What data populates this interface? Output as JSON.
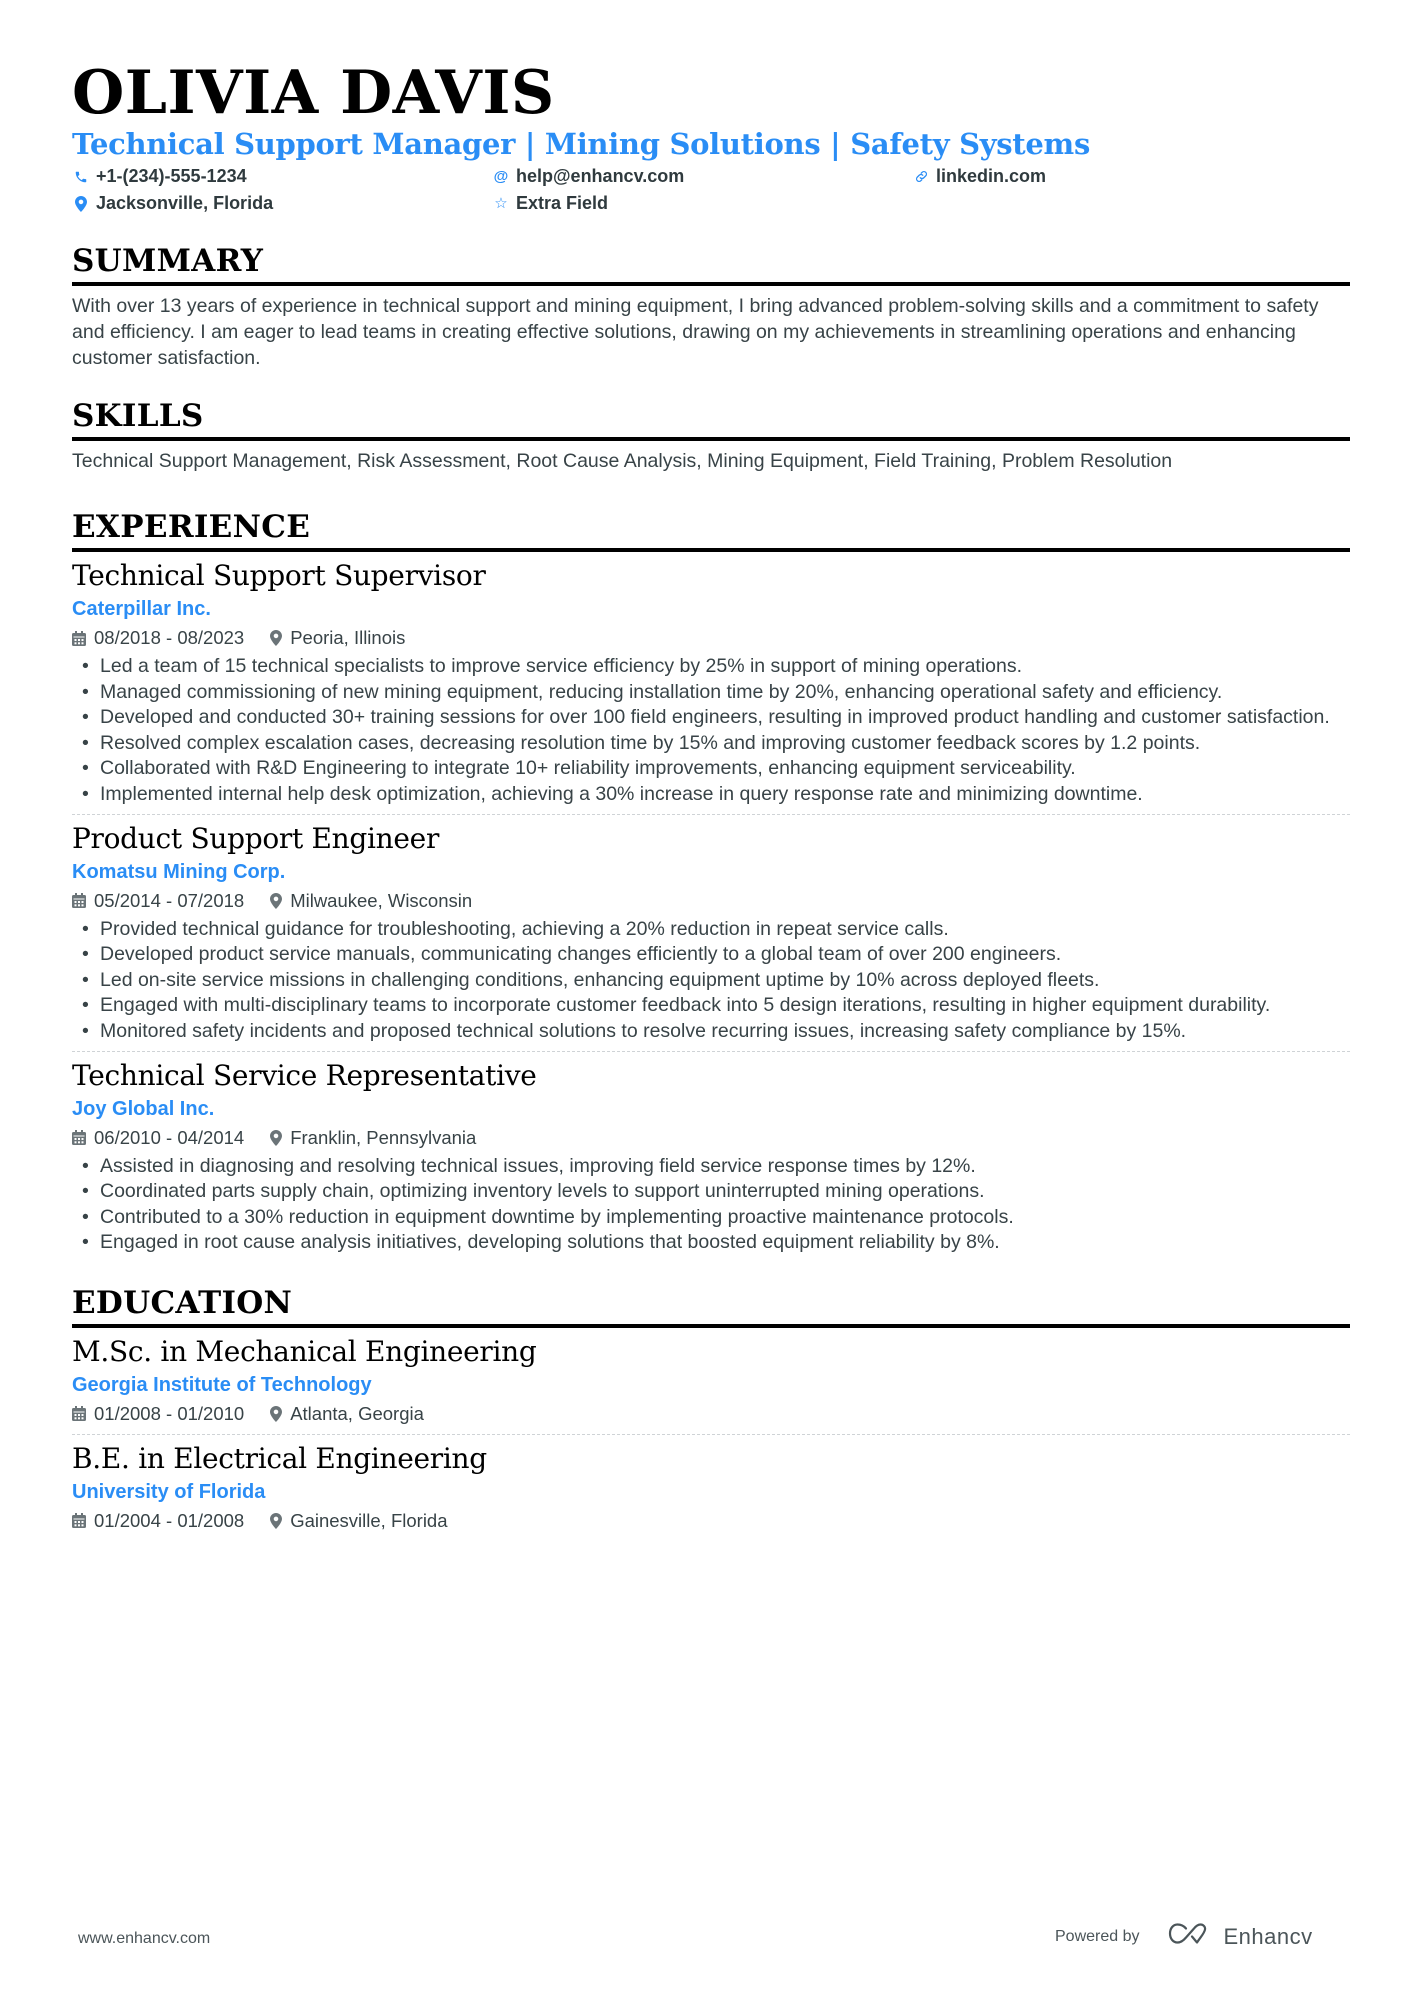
{
  "header": {
    "name": "OLIVIA DAVIS",
    "headline": "Technical Support Manager | Mining Solutions | Safety Systems",
    "contacts": [
      {
        "icon": "phone-icon",
        "value": "+1-(234)-555-1234"
      },
      {
        "icon": "at-icon",
        "value": "help@enhancv.com"
      },
      {
        "icon": "link-icon",
        "value": "linkedin.com"
      },
      {
        "icon": "location-icon",
        "value": "Jacksonville, Florida"
      },
      {
        "icon": "star-icon",
        "value": "Extra Field"
      }
    ]
  },
  "summary": {
    "title": "SUMMARY",
    "text": "With over 13 years of experience in technical support and mining equipment, I bring advanced problem-solving skills and a commitment to safety and efficiency. I am eager to lead teams in creating effective solutions, drawing on my achievements in streamlining operations and enhancing customer satisfaction."
  },
  "skills": {
    "title": "SKILLS",
    "text": "Technical Support Management, Risk Assessment, Root Cause Analysis, Mining Equipment, Field Training, Problem Resolution"
  },
  "experience": {
    "title": "EXPERIENCE",
    "items": [
      {
        "role": "Technical Support Supervisor",
        "company": "Caterpillar Inc.",
        "dates": "08/2018 - 08/2023",
        "location": "Peoria, Illinois",
        "bullets": [
          "Led a team of 15 technical specialists to improve service efficiency by 25% in support of mining operations.",
          "Managed commissioning of new mining equipment, reducing installation time by 20%, enhancing operational safety and efficiency.",
          "Developed and conducted 30+ training sessions for over 100 field engineers, resulting in improved product handling and customer satisfaction.",
          "Resolved complex escalation cases, decreasing resolution time by 15% and improving customer feedback scores by 1.2 points.",
          "Collaborated with R&D Engineering to integrate 10+ reliability improvements, enhancing equipment serviceability.",
          "Implemented internal help desk optimization, achieving a 30% increase in query response rate and minimizing downtime."
        ]
      },
      {
        "role": "Product Support Engineer",
        "company": "Komatsu Mining Corp.",
        "dates": "05/2014 - 07/2018",
        "location": "Milwaukee, Wisconsin",
        "bullets": [
          "Provided technical guidance for troubleshooting, achieving a 20% reduction in repeat service calls.",
          "Developed product service manuals, communicating changes efficiently to a global team of over 200 engineers.",
          "Led on-site service missions in challenging conditions, enhancing equipment uptime by 10% across deployed fleets.",
          "Engaged with multi-disciplinary teams to incorporate customer feedback into 5 design iterations, resulting in higher equipment durability.",
          "Monitored safety incidents and proposed technical solutions to resolve recurring issues, increasing safety compliance by 15%."
        ]
      },
      {
        "role": "Technical Service Representative",
        "company": "Joy Global Inc.",
        "dates": "06/2010 - 04/2014",
        "location": "Franklin, Pennsylvania",
        "bullets": [
          "Assisted in diagnosing and resolving technical issues, improving field service response times by 12%.",
          "Coordinated parts supply chain, optimizing inventory levels to support uninterrupted mining operations.",
          "Contributed to a 30% reduction in equipment downtime by implementing proactive maintenance protocols.",
          "Engaged in root cause analysis initiatives, developing solutions that boosted equipment reliability by 8%."
        ]
      }
    ]
  },
  "education": {
    "title": "EDUCATION",
    "items": [
      {
        "degree": "M.Sc. in Mechanical Engineering",
        "school": "Georgia Institute of Technology",
        "dates": "01/2008 - 01/2010",
        "location": "Atlanta, Georgia"
      },
      {
        "degree": "B.E. in Electrical Engineering",
        "school": "University of Florida",
        "dates": "01/2004 - 01/2008",
        "location": "Gainesville, Florida"
      }
    ]
  },
  "footer": {
    "website": "www.enhancv.com",
    "powered_by": "Powered by",
    "brand": "Enhancv"
  },
  "colors": {
    "accent": "#2a8df5",
    "text": "#384347",
    "heading": "#000000"
  }
}
